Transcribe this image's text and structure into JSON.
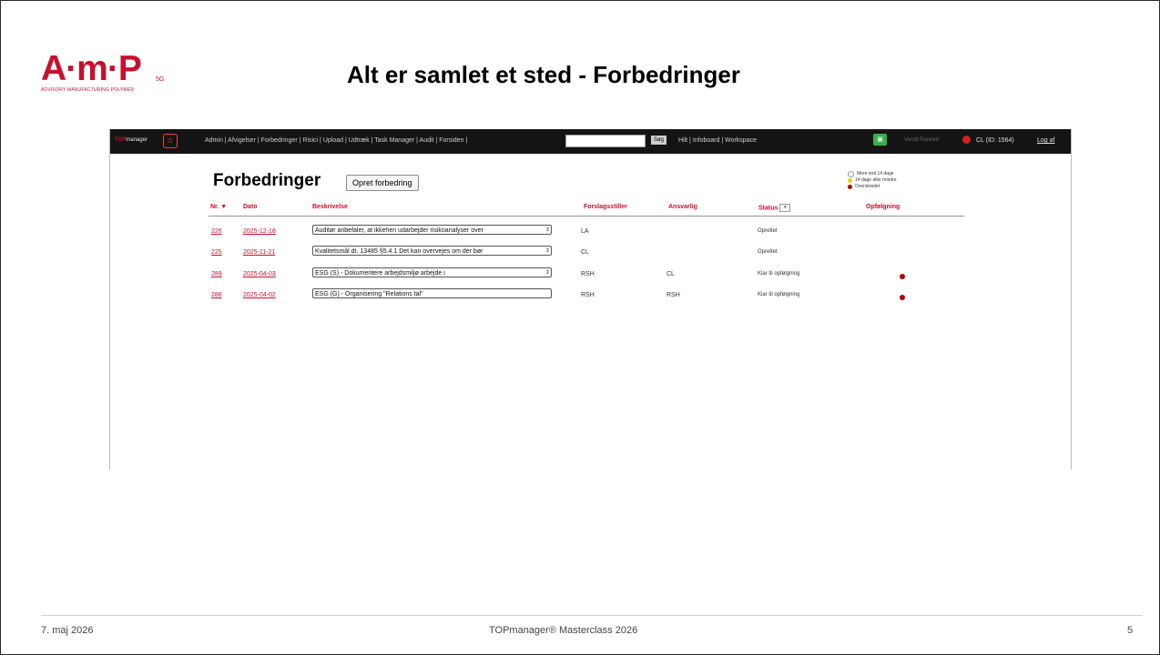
{
  "slide": {
    "logo_text": "A·m·P",
    "logo_sub": "ADVISORY MANUFACTURING POLYMER",
    "logo_small": "5G",
    "title": "Alt er samlet et sted - Forbedringer",
    "footer_left": "7. maj 2026",
    "footer_center": "TOPmanager® Masterclass 2026",
    "footer_page": "5"
  },
  "topbar": {
    "brand_prefix": "TOP",
    "brand_suffix": "manager",
    "nav": "Admin | Afvigelser | Forbedringer | Risici | Upload | Udtræk | Task Manager | Audit | Forsiden |",
    "search_value": "",
    "search_button": "Søg",
    "nav2": "Hilt | Infoboard | Workspace",
    "chat_label": "",
    "dim_text": "Vendt Rannerl",
    "user": "CL (ID: 1564)",
    "logout": "Log af"
  },
  "page": {
    "heading": "Forbedringer",
    "create_button": "Opret forbedring",
    "legend": [
      {
        "label": "Mere end 14 dage",
        "color": "#ffffff"
      },
      {
        "label": "14 dage eller mindre",
        "color": "#f0d000"
      },
      {
        "label": "Overskredet",
        "color": "#b40000"
      }
    ]
  },
  "table": {
    "columns": [
      "Nr. ▼",
      "Dato",
      "Beskrivelse",
      "Forslagsstiller",
      "Ansvarlig",
      "Status",
      "Opfølgning"
    ],
    "status_filter_label": "▾",
    "rows": [
      {
        "nr": "226",
        "dato": "2025-12-18",
        "beskrivelse": "Auditør anbefaler, at ikkehen udarbejder risikoanalyser over",
        "forslagsstiller": "LA",
        "ansvarlig": "",
        "status": "Oprettet",
        "followup": false
      },
      {
        "nr": "225",
        "dato": "2025-11-21",
        "beskrivelse": "Kvalitetsmål dt. 13485 §5.4.1 Det kan overvejes om der bør",
        "forslagsstiller": "CL",
        "ansvarlig": "",
        "status": "Oprettet",
        "followup": false
      },
      {
        "nr": "289",
        "dato": "2025-04-03",
        "beskrivelse": "ESG (S) - Dokumentere arbejdsmiljø arbejde i",
        "forslagsstiller": "RSH",
        "ansvarlig": "CL",
        "status": "Klar til opfølgning",
        "followup": true
      },
      {
        "nr": "288",
        "dato": "2025-04-02",
        "beskrivelse": "ESG (G) - Organisering \"Relations tal\"",
        "forslagsstiller": "RSH",
        "ansvarlig": "RSH",
        "status": "Klar til opfølgning",
        "followup": true
      }
    ]
  }
}
